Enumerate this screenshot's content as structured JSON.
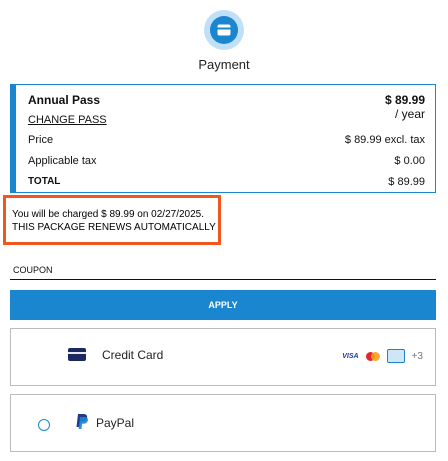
{
  "header": {
    "icon": "wallet-icon",
    "title": "Payment"
  },
  "summary": {
    "plan_name": "Annual Pass",
    "plan_price": "$ 89.99",
    "per_period": "/ year",
    "change_link": "CHANGE PASS",
    "rows": [
      {
        "label": "Price",
        "value": "$ 89.99 excl. tax"
      },
      {
        "label": "Applicable tax",
        "value": "$ 0.00"
      }
    ],
    "total_label": "TOTAL",
    "total_value": "$ 89.99",
    "accent_color": "#1a86d0"
  },
  "notice": {
    "charge_text": "You will be charged $ 89.99 on 02/27/2025.",
    "renew_text": "THIS PACKAGE RENEWS AUTOMATICALLY",
    "highlight_color": "#f0561e"
  },
  "coupon": {
    "label": "COUPON",
    "value": "",
    "apply_label": "APPLY"
  },
  "payment_methods": [
    {
      "label": "Credit Card",
      "icon": "credit-card-icon",
      "brands": [
        "VISA",
        "mastercard",
        "card"
      ],
      "more": "+3"
    },
    {
      "label": "PayPal",
      "icon": "paypal-icon",
      "selected": false
    }
  ]
}
